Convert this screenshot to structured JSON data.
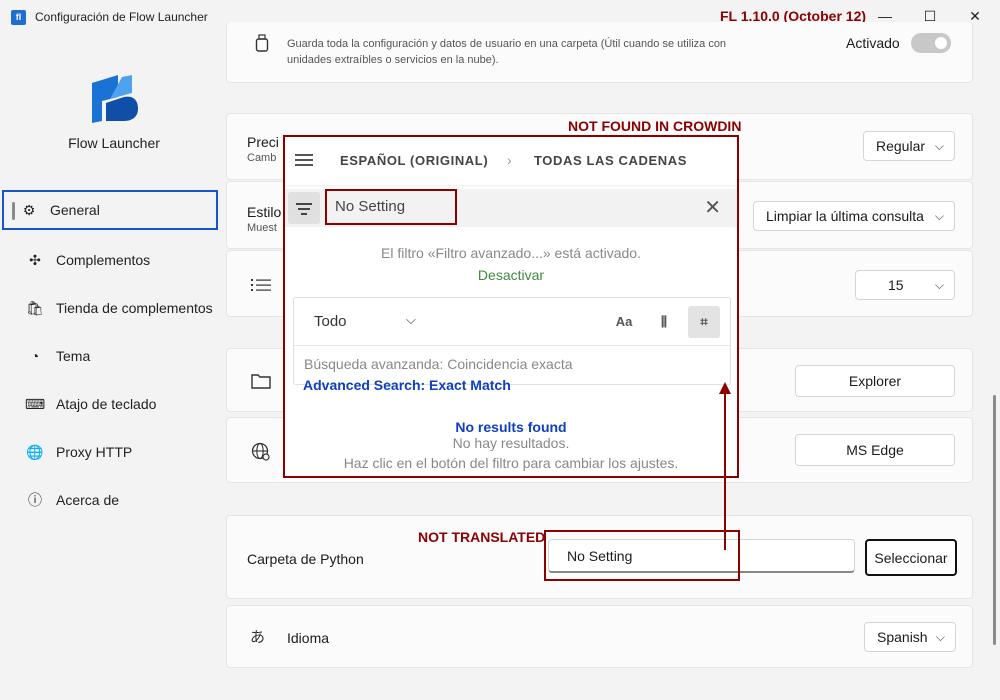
{
  "window": {
    "title": "Configuración de Flow Launcher",
    "version_annotation": "FL 1.10.0 (October 12)",
    "icon_letter": "fl",
    "controls": {
      "minimize": "—",
      "maximize": "☐",
      "close": "✕"
    }
  },
  "sidebar": {
    "brand": "Flow Launcher",
    "items": [
      {
        "label": "General",
        "icon": "gear-icon",
        "glyph": "⚙"
      },
      {
        "label": "Complementos",
        "icon": "puzzle-icon",
        "glyph": "✣"
      },
      {
        "label": "Tienda de complementos",
        "icon": "shopping-bag-icon",
        "glyph": "🛍"
      },
      {
        "label": "Tema",
        "icon": "palette-icon",
        "glyph": "◔"
      },
      {
        "label": "Atajo de teclado",
        "icon": "keyboard-icon",
        "glyph": "⌨"
      },
      {
        "label": "Proxy HTTP",
        "icon": "globe-icon",
        "glyph": "🌐"
      },
      {
        "label": "Acerca de",
        "icon": "info-icon",
        "glyph": "ⓘ"
      }
    ]
  },
  "settings": {
    "portable": {
      "description_line1": "Guarda toda la configuración y datos de usuario en una carpeta (Útil cuando se utiliza con",
      "description_line2": "unidades extraíbles o servicios en la nube).",
      "toggle_label": "Activado"
    },
    "row2": {
      "label": "Preci",
      "sub": "Camb",
      "value": "Regular"
    },
    "row3": {
      "label": "Estilo",
      "sub": "Muest",
      "value": "Limpiar la última consulta"
    },
    "row4": {
      "value": "15"
    },
    "file_manager": {
      "button": "Explorer"
    },
    "browser": {
      "button": "MS Edge"
    },
    "python": {
      "label": "Carpeta de Python",
      "value": "No Setting",
      "button": "Seleccionar"
    },
    "language": {
      "label": "Idioma",
      "value": "Spanish"
    }
  },
  "annotations": {
    "not_found": "NOT FOUND IN CROWDIN",
    "not_translated": "NOT TRANSLATED",
    "advanced_search_en": "Advanced Search: Exact Match",
    "no_results_en": "No results found"
  },
  "crowdin": {
    "breadcrumb_1": "ESPAÑOL (ORIGINAL)",
    "breadcrumb_sep": "›",
    "breadcrumb_2": "TODAS LAS CADENAS",
    "search_value": "No Setting",
    "filter_msg": "El filtro «Filtro avanzado...» está activado.",
    "deactivate": "Desactivar",
    "select_value": "Todo",
    "tool_case": "Aa",
    "advanced_search": "Búsqueda avanzanda: Coincidencia exacta",
    "no_results": "No hay resultados.",
    "hint": "Haz clic en el botón del filtro para cambiar los ajustes."
  }
}
